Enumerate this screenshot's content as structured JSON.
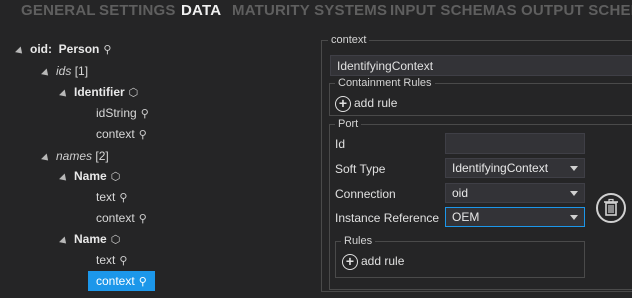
{
  "tabs": [
    {
      "label": "GENERAL",
      "active": false
    },
    {
      "label": "SETTINGS",
      "active": false
    },
    {
      "label": "DATA",
      "active": true
    },
    {
      "label": "MATURITY SYSTEMS",
      "active": false
    },
    {
      "label": "INPUT SCHEMAS",
      "active": false
    },
    {
      "label": "OUTPUT SCHEM",
      "active": false
    }
  ],
  "tree": {
    "root_name": "oid:",
    "root_type": "Person",
    "ids_label": "ids",
    "ids_count": "[1]",
    "identifier_label": "Identifier",
    "idstring_label": "idString",
    "context_label_1": "context",
    "names_label": "names",
    "names_count": "[2]",
    "name_label_1": "Name",
    "text_label_1": "text",
    "context_label_2": "context",
    "name_label_2": "Name",
    "text_label_2": "text",
    "context_label_3": "context"
  },
  "panel": {
    "context_legend": "context",
    "context_value": "IdentifyingContext",
    "containment_legend": "Containment Rules",
    "containment_add": "add rule",
    "port_legend": "Port",
    "id_label": "Id",
    "id_value": "",
    "soft_type_label": "Soft Type",
    "soft_type_value": "IdentifyingContext",
    "connection_label": "Connection",
    "connection_value": "oid",
    "instance_ref_label": "Instance Reference",
    "instance_ref_value": "OEM",
    "rules_legend": "Rules",
    "rules_add": "add rule"
  },
  "icons": {
    "link": "link-icon",
    "cube": "cube-icon",
    "trash": "trash-icon",
    "plus": "plus-circle-icon"
  },
  "colors": {
    "accent": "#1c97ea",
    "background": "#252526",
    "tab_inactive": "#5f5f5f"
  }
}
